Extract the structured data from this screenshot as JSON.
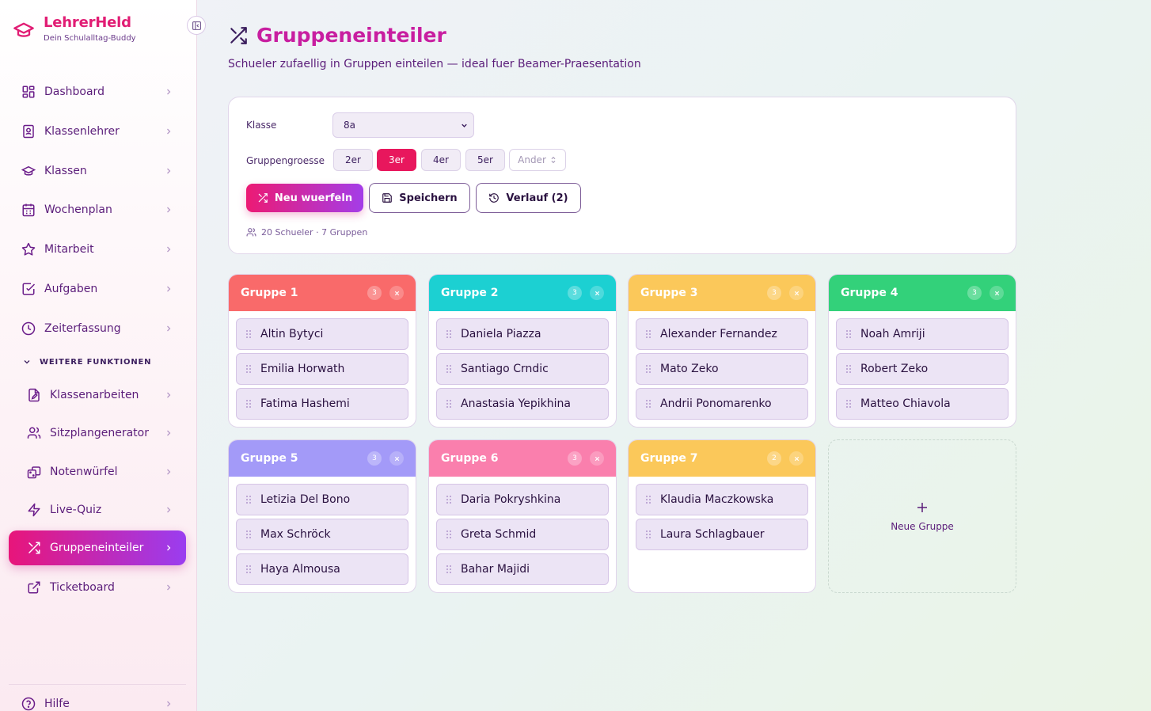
{
  "brand": {
    "title": "LehrerHeld",
    "subtitle": "Dein Schulalltag-Buddy"
  },
  "sidebar": {
    "items": [
      {
        "label": "Dashboard",
        "icon": "grid-icon"
      },
      {
        "label": "Klassenlehrer",
        "icon": "contact-book-icon"
      },
      {
        "label": "Klassen",
        "icon": "graduation-cap-icon"
      },
      {
        "label": "Wochenplan",
        "icon": "calendar-icon"
      },
      {
        "label": "Mitarbeit",
        "icon": "star-icon"
      },
      {
        "label": "Aufgaben",
        "icon": "checkbox-icon"
      },
      {
        "label": "Zeiterfassung",
        "icon": "clock-icon"
      }
    ],
    "section_label": "WEITERE FUNKTIONEN",
    "sub_items": [
      {
        "label": "Klassenarbeiten",
        "icon": "file-edit-icon"
      },
      {
        "label": "Sitzplangenerator",
        "icon": "users-icon"
      },
      {
        "label": "Notenwürfel",
        "icon": "dice-icon"
      },
      {
        "label": "Live-Quiz",
        "icon": "bolt-icon"
      },
      {
        "label": "Gruppeneinteiler",
        "icon": "shuffle-icon",
        "active": true
      },
      {
        "label": "Ticketboard",
        "icon": "external-link-icon"
      }
    ],
    "help_label": "Hilfe"
  },
  "page": {
    "title": "Gruppeneinteiler",
    "subtitle": "Schueler zufaellig in Gruppen einteilen — ideal fuer Beamer-Praesentation"
  },
  "controls": {
    "class_label": "Klasse",
    "class_value": "8a",
    "size_label": "Gruppengroesse",
    "sizes": [
      "2er",
      "3er",
      "4er",
      "5er"
    ],
    "selected_size": "3er",
    "other_size_placeholder": "Ander",
    "reroll_label": "Neu wuerfeln",
    "save_label": "Speichern",
    "history_label": "Verlauf (2)",
    "meta": "20 Schueler · 7 Gruppen"
  },
  "groups": [
    {
      "name": "Gruppe 1",
      "count": "3",
      "color": "#f96a6a",
      "members": [
        "Altin Bytyci",
        "Emilia Horwath",
        "Fatima Hashemi"
      ]
    },
    {
      "name": "Gruppe 2",
      "count": "3",
      "color": "#1cd0d2",
      "members": [
        "Daniela Piazza",
        "Santiago Crndic",
        "Anastasia Yepikhina"
      ]
    },
    {
      "name": "Gruppe 3",
      "count": "3",
      "color": "#fbc85a",
      "members": [
        "Alexander Fernandez",
        "Mato Zeko",
        "Andrii Ponomarenko"
      ]
    },
    {
      "name": "Gruppe 4",
      "count": "3",
      "color": "#33d17a",
      "members": [
        "Noah Amriji",
        "Robert Zeko",
        "Matteo Chiavola"
      ]
    },
    {
      "name": "Gruppe 5",
      "count": "3",
      "color": "#a39af8",
      "members": [
        "Letizia Del Bono",
        "Max Schröck",
        "Haya Almousa"
      ]
    },
    {
      "name": "Gruppe 6",
      "count": "3",
      "color": "#fa7fad",
      "members": [
        "Daria Pokryshkina",
        "Greta Schmid",
        "Bahar Majidi"
      ]
    },
    {
      "name": "Gruppe 7",
      "count": "2",
      "color": "#fbc85a",
      "members": [
        "Klaudia Maczkowska",
        "Laura Schlagbauer"
      ]
    }
  ],
  "new_group_label": "Neue Gruppe"
}
